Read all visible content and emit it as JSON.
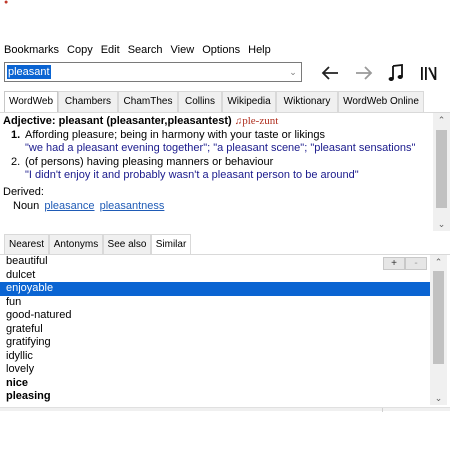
{
  "menu": [
    "Bookmarks",
    "Copy",
    "Edit",
    "Search",
    "View",
    "Options",
    "Help"
  ],
  "search": {
    "value": "pleasant"
  },
  "toolbar_icons": [
    "back-arrow-icon",
    "forward-arrow-icon",
    "music-note-icon",
    "library-icon"
  ],
  "dictionary_tabs": {
    "active": "WordWeb",
    "items": [
      "WordWeb",
      "Chambers",
      "ChamThes",
      "Collins",
      "Wikipedia",
      "Wiktionary",
      "WordWeb Online"
    ]
  },
  "definition": {
    "pos": "Adjective:",
    "headword": "pleasant (pleasanter,pleasantest)",
    "pronunciation": "ple-zunt",
    "senses": [
      {
        "num": "1.",
        "text": "Affording pleasure; being in harmony with your taste or likings",
        "example": "\"we had a pleasant evening together\"; \"a pleasant scene\"; \"pleasant sensations\""
      },
      {
        "num": "2.",
        "text": "(of persons) having pleasing manners or behaviour",
        "example": "\"I didn't enjoy it and probably wasn't a pleasant person to be around\""
      }
    ],
    "derived_label": "Derived:",
    "derived_pos": "Noun",
    "derived_links": [
      "pleasance",
      "pleasantness"
    ]
  },
  "relation_tabs": {
    "active": "Similar",
    "items": [
      "Nearest",
      "Antonyms",
      "See also",
      "Similar"
    ]
  },
  "list_buttons": {
    "plus": "+",
    "minus": "-"
  },
  "similar_words": [
    {
      "word": "beautiful",
      "bold": false,
      "selected": false
    },
    {
      "word": "dulcet",
      "bold": false,
      "selected": false
    },
    {
      "word": "enjoyable",
      "bold": false,
      "selected": true
    },
    {
      "word": "fun",
      "bold": false,
      "selected": false
    },
    {
      "word": "good-natured",
      "bold": false,
      "selected": false
    },
    {
      "word": "grateful",
      "bold": false,
      "selected": false
    },
    {
      "word": "gratifying",
      "bold": false,
      "selected": false
    },
    {
      "word": "idyllic",
      "bold": false,
      "selected": false
    },
    {
      "word": "lovely",
      "bold": false,
      "selected": false
    },
    {
      "word": "nice",
      "bold": true,
      "selected": false
    },
    {
      "word": "pleasing",
      "bold": true,
      "selected": false
    }
  ],
  "colors": {
    "selection": "#0a64d2",
    "example_text": "#1a1a8c",
    "link": "#1f5bb6",
    "pronunciation": "#b03020"
  }
}
